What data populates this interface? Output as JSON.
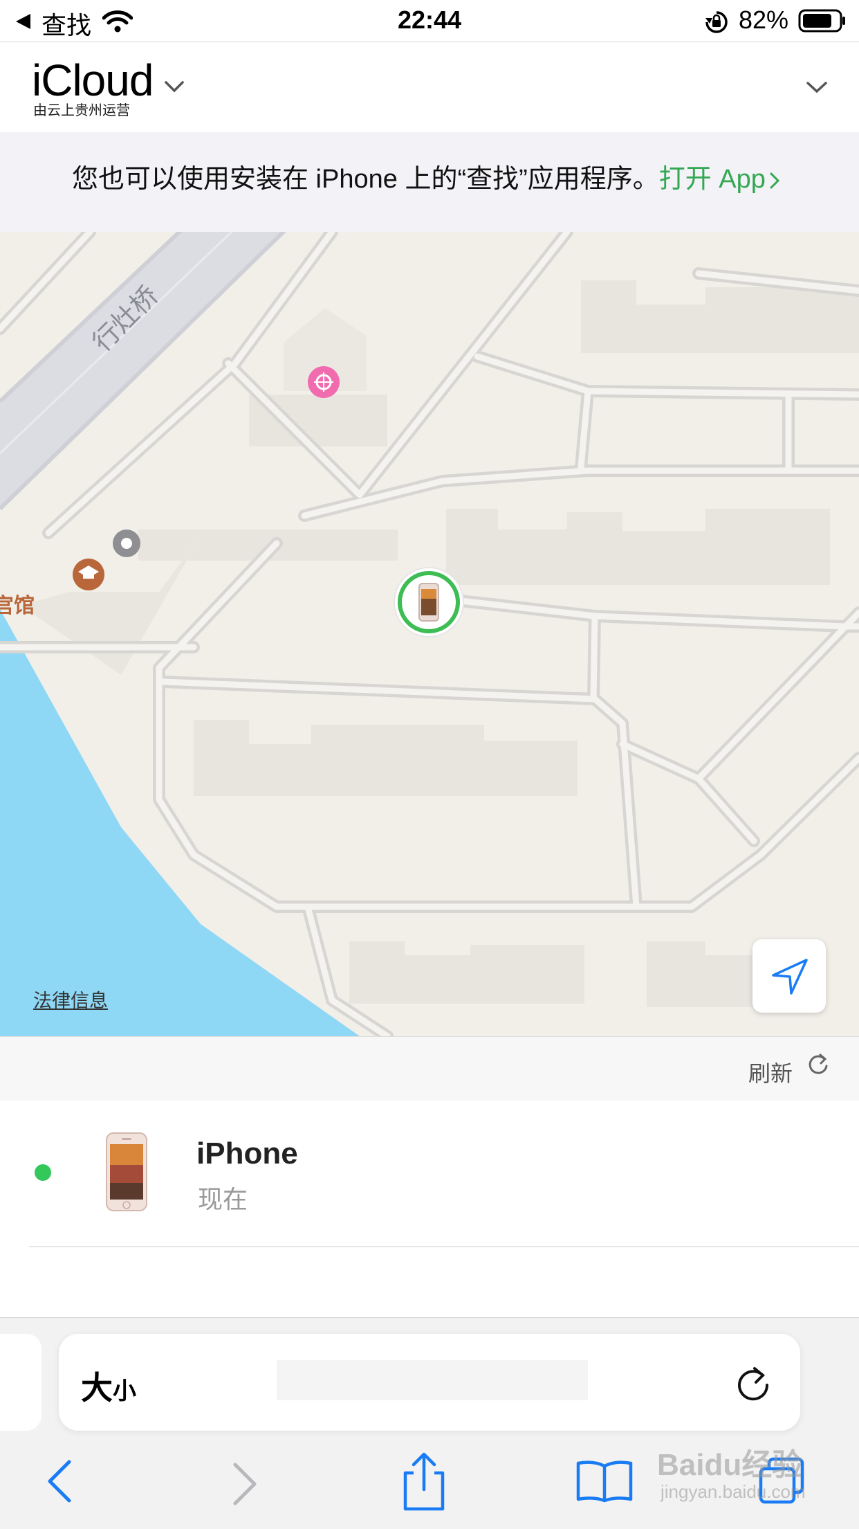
{
  "status_bar": {
    "back_label": "查找",
    "time": "22:44",
    "battery_percent": "82%",
    "battery_level": 0.82
  },
  "header": {
    "title": "iCloud",
    "subtitle": "由云上贵州运营"
  },
  "banner": {
    "text": "您也可以使用安装在 iPhone 上的“查找”应用程序。",
    "link": "打开 App",
    "link_color": "#34a853"
  },
  "map": {
    "road_label": "行灶桥",
    "partial_label": "宫馆",
    "legal_link": "法律信息",
    "water_color": "#8ed8f5"
  },
  "list": {
    "refresh_label": "刷新",
    "device": {
      "name": "iPhone",
      "time": "现在",
      "status_color": "#34c759"
    }
  },
  "safari": {
    "text_size_large": "大",
    "text_size_small": "小",
    "accent_color": "#1a7cf5"
  },
  "watermark": {
    "main": "Baidu经验",
    "sub": "jingyan.baidu.com"
  }
}
